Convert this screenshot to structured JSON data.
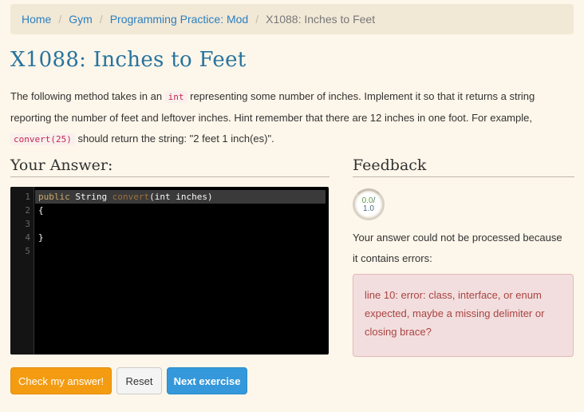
{
  "breadcrumb": {
    "items": [
      "Home",
      "Gym",
      "Programming Practice: Mod"
    ],
    "current": "X1088: Inches to Feet",
    "separator": "/"
  },
  "title": "X1088: Inches to Feet",
  "description": {
    "part1": "The following method takes in an ",
    "code1": "int",
    "part2": " representing some number of inches. Implement it so that it returns a string reporting the number of feet and leftover inches. Hint remember that there are 12 inches in one foot. For example, ",
    "code2": "convert(25)",
    "part3": " should return the string: \"2 feet 1 inch(es)\"."
  },
  "answer_heading": "Your Answer:",
  "feedback_heading": "Feedback",
  "editor": {
    "line_numbers": [
      "1",
      "2",
      "3",
      "4",
      "5"
    ],
    "lines": [
      {
        "kw": "public",
        "type": " String ",
        "fn": "convert",
        "rest": "(int inches)"
      },
      {
        "text": "{"
      },
      {
        "text": ""
      },
      {
        "text": "}"
      },
      {
        "text": ""
      }
    ]
  },
  "score": {
    "earned": "0.0",
    "separator": "/",
    "total": "1.0"
  },
  "feedback_message": "Your answer could not be processed because it contains errors:",
  "error_text": "line 10: error: class, interface, or enum expected, maybe a missing delimiter or closing brace?",
  "buttons": {
    "check": "Check my answer!",
    "reset": "Reset",
    "next": "Next exercise"
  },
  "colors": {
    "accent_title": "#27739e",
    "link": "#2a7fc0",
    "check_button": "#f39c12",
    "next_button": "#3498db",
    "error_bg": "#f2dede",
    "error_text": "#a94442"
  }
}
